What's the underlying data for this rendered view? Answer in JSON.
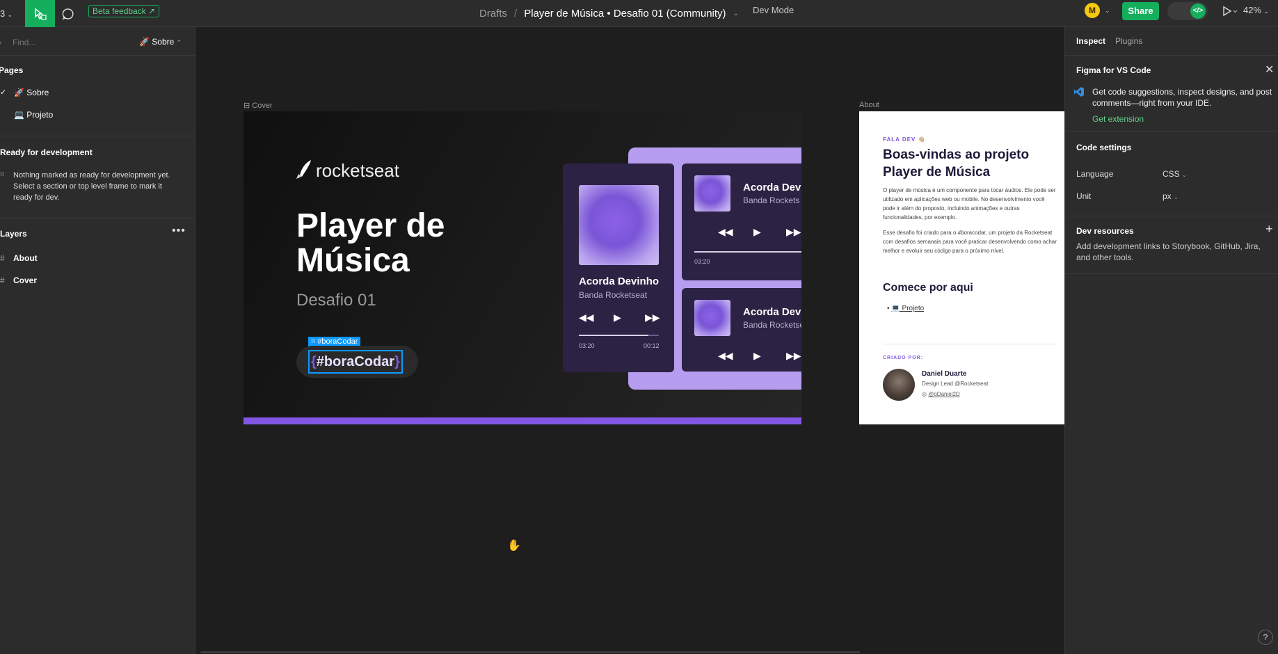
{
  "topbar": {
    "menu_label": "3",
    "beta_label": "Beta feedback ↗",
    "breadcrumb": {
      "drafts": "Drafts",
      "separator": "/",
      "file": "Player de Música • Desafio 01 (Community)"
    },
    "dev_mode_label": "Dev Mode",
    "avatar_initial": "M",
    "share_label": "Share",
    "dev_toggle_label": "</>",
    "zoom": "42%"
  },
  "left_panel": {
    "search_placeholder": "Find...",
    "current_page": "🚀 Sobre",
    "pages_header": "Pages",
    "pages": [
      {
        "label": "🚀 Sobre",
        "selected": true
      },
      {
        "label": "💻 Projeto",
        "selected": false
      }
    ],
    "ready_header": "Ready for development",
    "ready_text": "Nothing marked as ready for development yet. Select a section or top level frame to mark it ready for dev.",
    "layers_header": "Layers",
    "layers": [
      {
        "label": "About"
      },
      {
        "label": "Cover"
      }
    ]
  },
  "canvas": {
    "cover_label": "Cover",
    "about_label": "About",
    "cover": {
      "brand": "rocketseat",
      "title_line1": "Player de",
      "title_line2": "Música",
      "subtitle": "Desafio 01",
      "selection_tag": "#boraCodar",
      "hashtag_open": "{",
      "hashtag": "#boraCodar",
      "hashtag_close": "}",
      "player_large": {
        "track": "Acorda Devinho",
        "artist": "Banda Rocketseat",
        "elapsed": "03:20",
        "remaining": "00:12",
        "progress": 0.87
      },
      "player_top": {
        "track": "Acorda Devin",
        "artist": "Banda Rockets",
        "elapsed": "03:20"
      },
      "player_bottom": {
        "track": "Acorda Devi",
        "artist": "Banda Rocketse"
      }
    },
    "about": {
      "eyebrow": "FALA DEV 👋🏼",
      "title": "Boas-vindas ao projeto Player de Música",
      "para1": "O player de música é um componente para tocar áudios. Ele pode ser utilizado em aplicações web ou mobile. No desenvolvimento você pode ir além do proposto, incluindo animações e outras funcionalidades, por exemplo.",
      "para2": "Esse desafio foi criado para o #boracodar, um projeto da Rocketseat com desafios semanais para você praticar desenvolvendo como achar melhor e evoluir seu código para o próximo nível.",
      "start_title": "Comece por aqui",
      "start_link": "💻 Projeto",
      "created_label": "CRIADO POR:",
      "author_name": "Daniel Duarte",
      "author_role": "Design Lead @Rocketseat",
      "author_handle": "@oDaniel2D"
    }
  },
  "right_panel": {
    "tabs": [
      "Inspect",
      "Plugins"
    ],
    "vscode_title": "Figma for VS Code",
    "vscode_text": "Get code suggestions, inspect designs, and post comments—right from your IDE.",
    "get_extension": "Get extension",
    "code_settings": "Code settings",
    "language_label": "Language",
    "language_value": "CSS",
    "unit_label": "Unit",
    "unit_value": "px",
    "dev_resources": "Dev resources",
    "dev_resources_text": "Add development links to Storybook, GitHub, Jira, and other tools.",
    "help": "?"
  },
  "colors": {
    "accent_green": "#14ae5c",
    "brand_purple": "#8257e5",
    "panel_bg": "#2c2c2c",
    "canvas_bg": "#1e1e1e"
  }
}
